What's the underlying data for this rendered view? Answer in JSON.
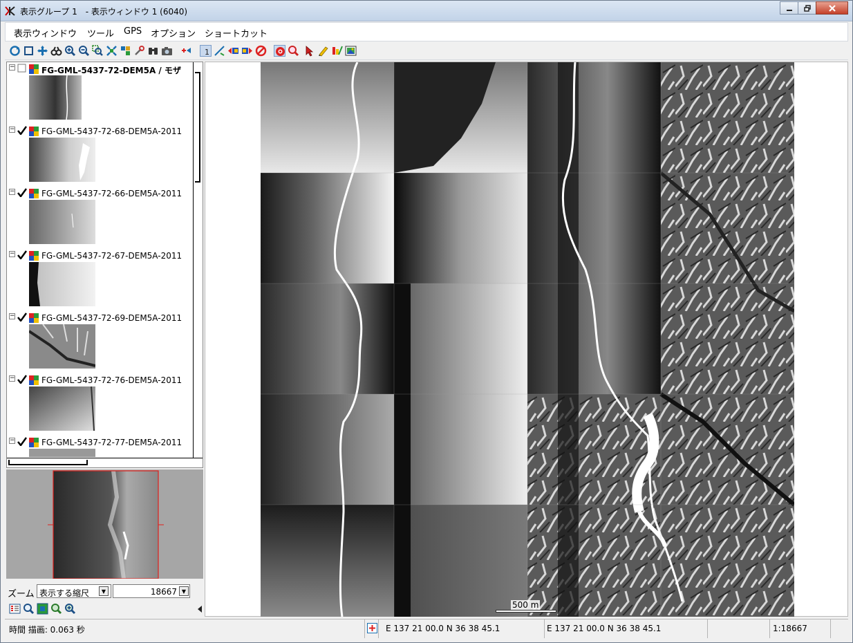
{
  "window": {
    "title": "表示グループ 1　- 表示ウィンドウ 1 (6040)"
  },
  "menu": [
    {
      "label": "表示ウィンドウ"
    },
    {
      "label": "ツール"
    },
    {
      "label": "GPS"
    },
    {
      "label": "オプション"
    },
    {
      "label": "ショートカット"
    }
  ],
  "toolbar_icons": [
    "redraw-icon",
    "full-extent-icon",
    "pan-icon",
    "binoculars-icon",
    "zoom-in-icon",
    "zoom-out-icon",
    "zoom-box-icon",
    "zoom-layer-icon",
    "zoom-previous-icon",
    "tools-icon",
    "find-icon",
    "camera-icon",
    "add-layer-icon",
    "select-number-icon",
    "measure-icon",
    "prev-layer-icon",
    "next-layer-icon",
    "no-entry-icon",
    "record-icon",
    "magnify-icon",
    "pointer-icon",
    "pencil-icon",
    "edit-icon",
    "image-icon"
  ],
  "layers": [
    {
      "name": "FG-GML-5437-72-DEM5A / モザ",
      "checked": false,
      "bold": true
    },
    {
      "name": "FG-GML-5437-72-68-DEM5A-2011",
      "checked": true
    },
    {
      "name": "FG-GML-5437-72-66-DEM5A-2011",
      "checked": true
    },
    {
      "name": "FG-GML-5437-72-67-DEM5A-2011",
      "checked": true
    },
    {
      "name": "FG-GML-5437-72-69-DEM5A-2011",
      "checked": true
    },
    {
      "name": "FG-GML-5437-72-76-DEM5A-2011",
      "checked": true
    },
    {
      "name": "FG-GML-5437-72-77-DEM5A-2011",
      "checked": true
    }
  ],
  "zoom": {
    "label": "ズーム",
    "mode": "表示する縮尺",
    "value": "18667"
  },
  "map": {
    "scalebar_label": "500 m"
  },
  "status": {
    "time": "時間 描画: 0.063 秒",
    "coord1": "E 137 21 00.0   N 36 38 45.1",
    "coord2": "E 137 21 00.0   N 36 38 45.1",
    "scale": "1:18667"
  },
  "colors": {
    "title_gradient_top": "#dbe6f3",
    "close_button": "#c5412a",
    "overview_frame": "#e0201c"
  }
}
